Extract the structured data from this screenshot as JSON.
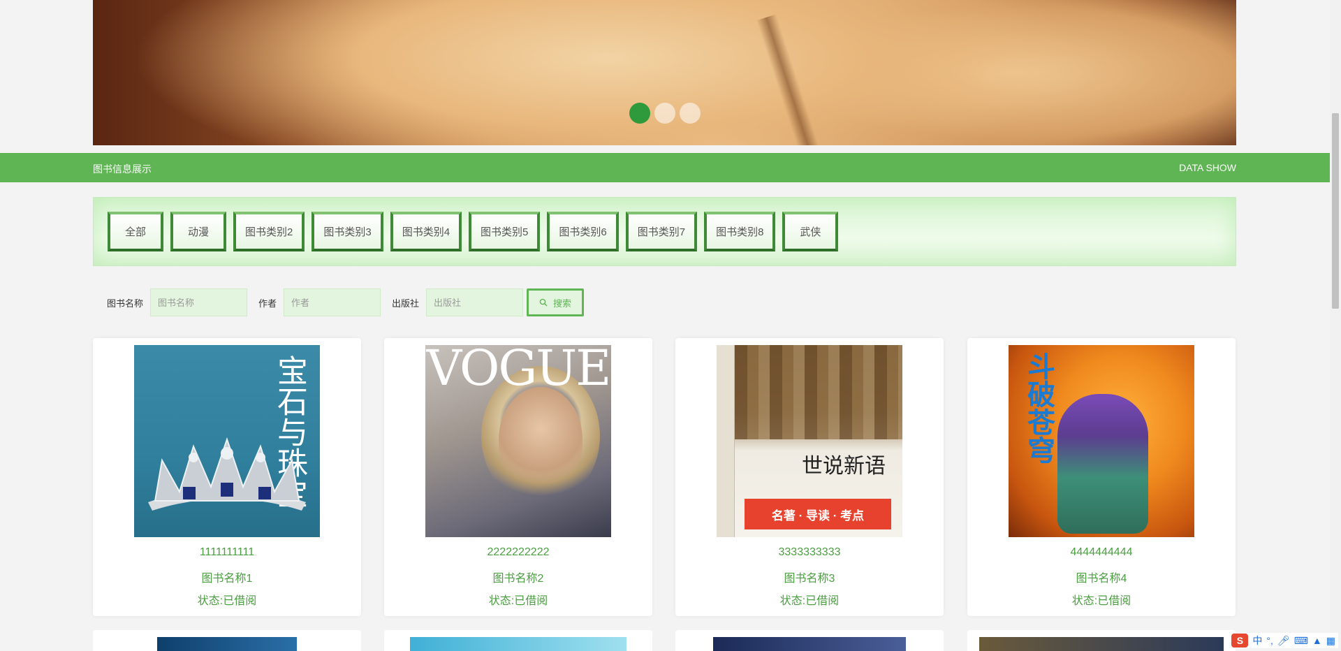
{
  "banner": {
    "dots": [
      {
        "active": true
      },
      {
        "active": false
      },
      {
        "active": false
      }
    ]
  },
  "section": {
    "title": "图书信息展示",
    "subtitle": "DATA SHOW"
  },
  "categories": [
    "全部",
    "动漫",
    "图书类别2",
    "图书类别3",
    "图书类别4",
    "图书类别5",
    "图书类别6",
    "图书类别7",
    "图书类别8",
    "武侠"
  ],
  "search": {
    "name_label": "图书名称",
    "name_placeholder": "图书名称",
    "author_label": "作者",
    "author_placeholder": "作者",
    "publisher_label": "出版社",
    "publisher_placeholder": "出版社",
    "button_label": "搜索"
  },
  "books": [
    {
      "code": "1111111111",
      "name": "图书名称1",
      "status": "状态:已借阅",
      "cover_text": "宝石与珠宝"
    },
    {
      "code": "2222222222",
      "name": "图书名称2",
      "status": "状态:已借阅",
      "cover_text": "VOGUE"
    },
    {
      "code": "3333333333",
      "name": "图书名称3",
      "status": "状态:已借阅",
      "cover_text": "世说新语"
    },
    {
      "code": "4444444444",
      "name": "图书名称4",
      "status": "状态:已借阅",
      "cover_text": "斗破苍穹"
    }
  ],
  "ime": {
    "logo": "S",
    "lang": "中"
  },
  "colors": {
    "accent": "#5fb454",
    "text_green": "#4a9e40",
    "dot_active": "#2e9a3c"
  }
}
